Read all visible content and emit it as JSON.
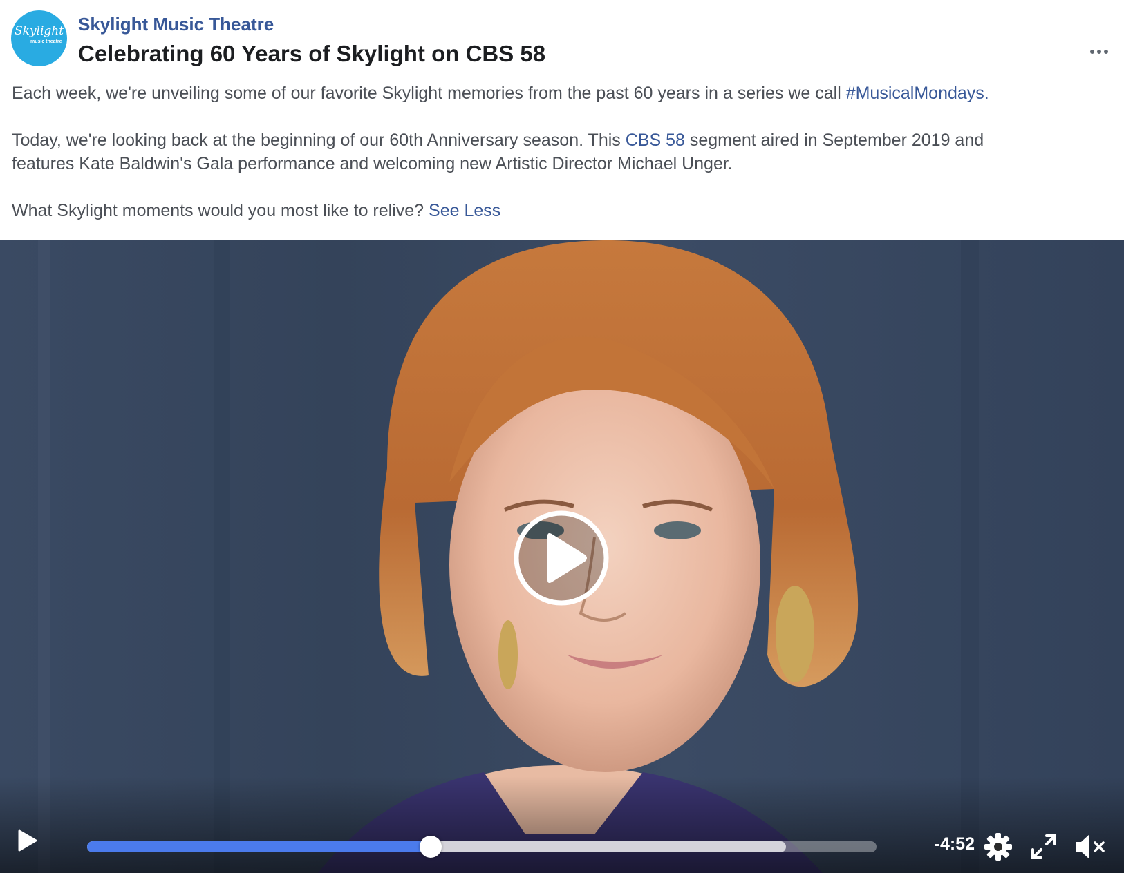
{
  "post": {
    "page_name": "Skylight Music Theatre",
    "title": "Celebrating 60 Years of Skylight on CBS 58",
    "avatar": {
      "logo_text": "Skylight",
      "logo_subtext": "music theatre",
      "color": "#29abe2"
    },
    "paragraph1": {
      "text": "Each week, we're unveiling some of our favorite Skylight memories from the past 60 years in a series we call ",
      "hashtag": "#MusicalMondays",
      "end": "."
    },
    "paragraph2": {
      "text_before": "Today, we're looking back at the beginning of our 60th Anniversary season. This ",
      "link": "CBS 58",
      "text_after": " segment aired in September 2019 and",
      "line2": "features Kate Baldwin's Gala performance and welcoming new Artistic Director Michael Unger."
    },
    "paragraph3": {
      "text": "What Skylight moments would you most like to relive? ",
      "see_less": "See Less"
    }
  },
  "video": {
    "time_remaining": "-4:52",
    "progress_played": 0.435,
    "progress_buffered": 0.885,
    "accent_color": "#4b7bec",
    "icons": [
      "play-icon",
      "settings-icon",
      "fullscreen-icon",
      "volume-muted-icon",
      "more-icon"
    ]
  }
}
